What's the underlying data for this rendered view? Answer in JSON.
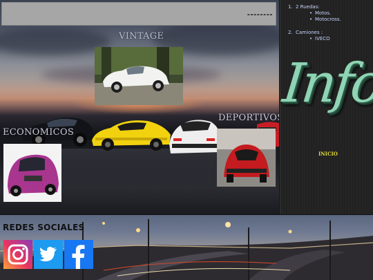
{
  "header": {
    "dashes": "--------"
  },
  "sections": {
    "vintage": "VINTAGE",
    "deportivos": "DEPORTIVOS",
    "economicos": "ECONOMICOS"
  },
  "side_menu": {
    "categories": [
      {
        "number": "1.",
        "title": "2 Ruedas:",
        "items": [
          "Motos.",
          "Motocross."
        ]
      },
      {
        "number": "2.",
        "title": "Camiones :",
        "items": [
          "IVECO"
        ]
      }
    ],
    "logo_text": "Info",
    "inicio": "INICIO"
  },
  "footer": {
    "redes_title": "REDES SOCIALES",
    "social_icons": [
      "instagram-icon",
      "twitter-icon",
      "facebook-icon"
    ]
  },
  "colors": {
    "header_gray": "#a6a6a6",
    "logo_green": "#8fd4b4",
    "inicio_yellow": "#e6dc3c",
    "instagram": "#d6336c",
    "twitter": "#1d9bf0",
    "facebook": "#1877f2"
  }
}
